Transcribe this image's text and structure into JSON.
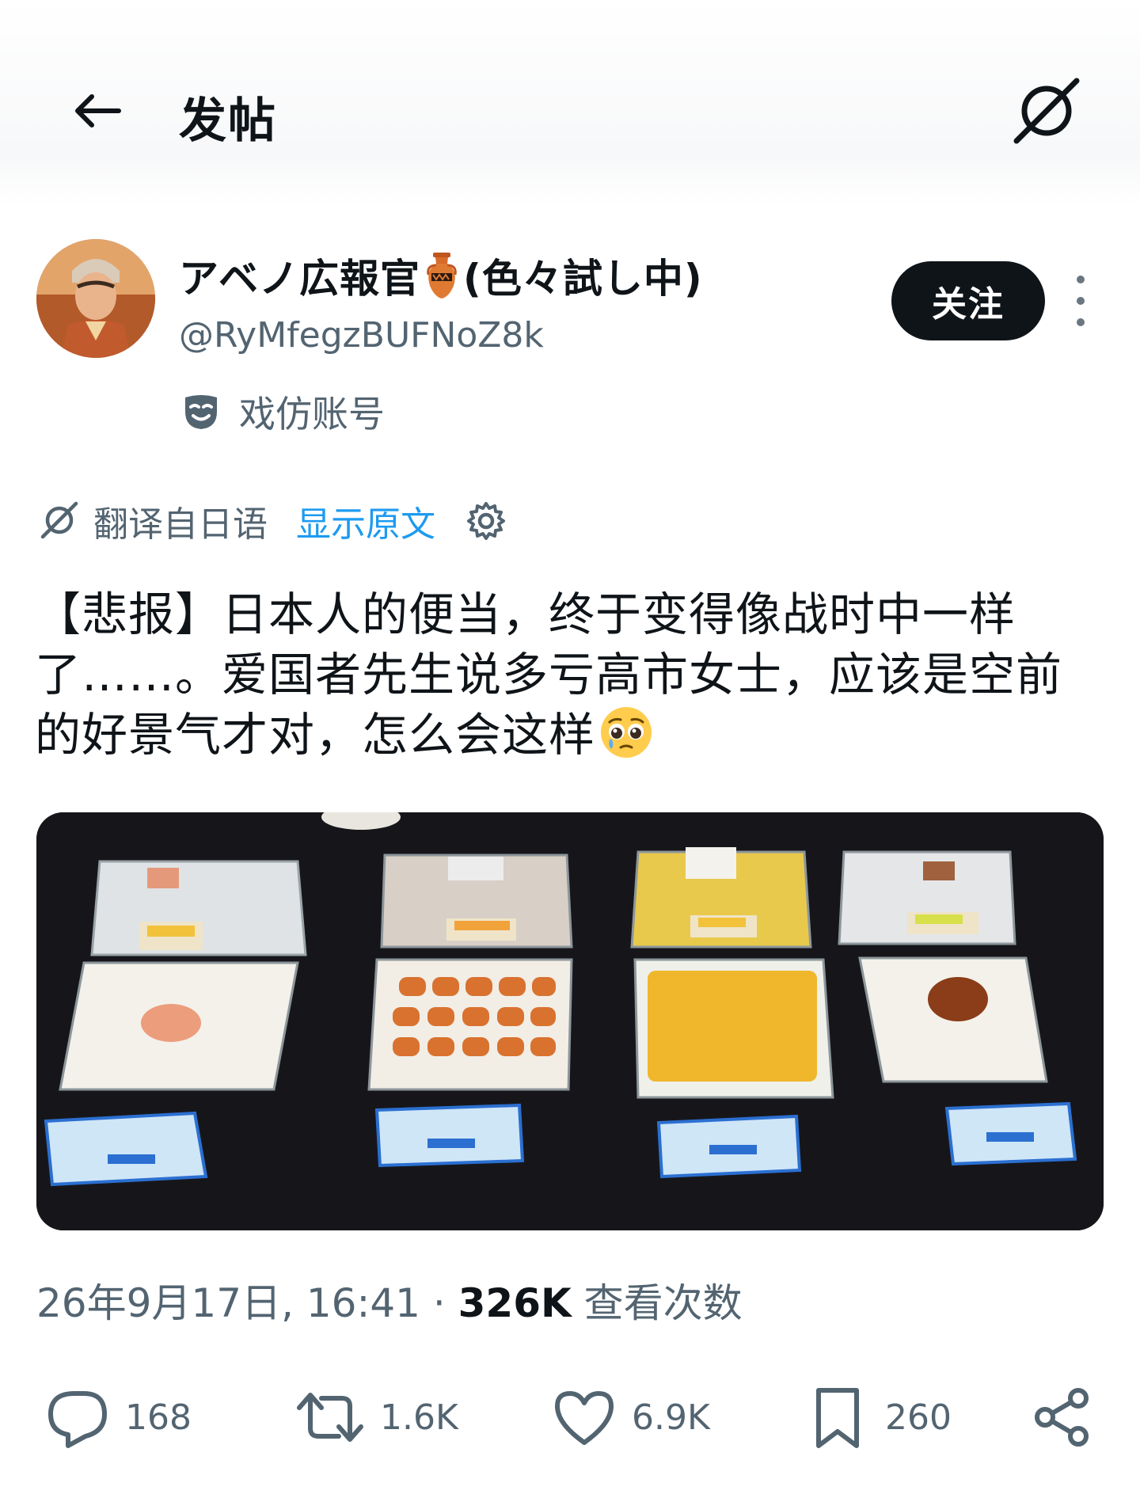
{
  "header": {
    "title": "发帖"
  },
  "author": {
    "display_name": "アベノ広報官",
    "display_name_suffix": "(色々試し中)",
    "handle": "@RyMfegzBUFNoZ8k",
    "parody_label": "戏仿账号",
    "follow_label": "关注"
  },
  "translation": {
    "label": "翻译自日语",
    "show_original": "显示原文"
  },
  "tweet": {
    "text": "【悲报】日本人的便当，终于变得像战时中一样了……。爱国者先生说多亏高市女士，应该是空前的好景气才对，怎么会这样"
  },
  "meta": {
    "timestamp": "26年9月17日, 16:41",
    "separator": " · ",
    "views_count": "326K",
    "views_label": " 查看次数"
  },
  "actions": {
    "replies": "168",
    "reposts": "1.6K",
    "likes": "6.9K",
    "bookmarks": "260"
  },
  "colors": {
    "accent": "#1d9bf0",
    "text_primary": "#0f1419",
    "text_secondary": "#536471"
  }
}
